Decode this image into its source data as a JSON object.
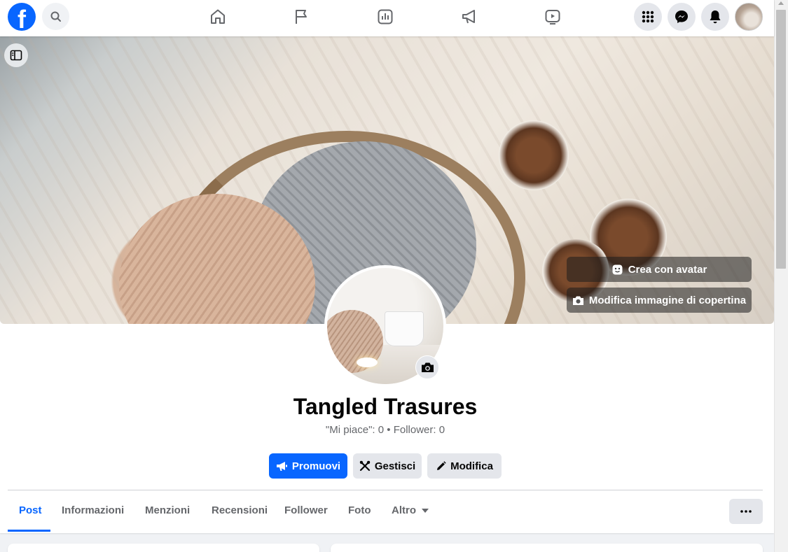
{
  "topbar": {
    "logo_letter": "f",
    "nav_icons": [
      "home-icon",
      "flag-icon",
      "insights-icon",
      "megaphone-icon",
      "video-icon"
    ],
    "right_icons": [
      "menu-grid-icon",
      "messenger-icon",
      "bell-icon"
    ]
  },
  "cover": {
    "create_avatar_label": "Crea con avatar",
    "edit_cover_label": "Modifica immagine di copertina"
  },
  "profile": {
    "name": "Tangled Trasures",
    "stats": "\"Mi piace\": 0 • Follower: 0"
  },
  "actions": {
    "promote_label": "Promuovi",
    "manage_label": "Gestisci",
    "edit_label": "Modifica"
  },
  "tabs": [
    {
      "label": "Post",
      "active": true
    },
    {
      "label": "Informazioni"
    },
    {
      "label": "Menzioni"
    },
    {
      "label": "Recensioni"
    },
    {
      "label": "Follower"
    },
    {
      "label": "Foto"
    },
    {
      "label": "Altro"
    }
  ],
  "colors": {
    "accent": "#0866ff",
    "button_grey": "#e4e6eb",
    "secondary_text": "#65676b"
  }
}
